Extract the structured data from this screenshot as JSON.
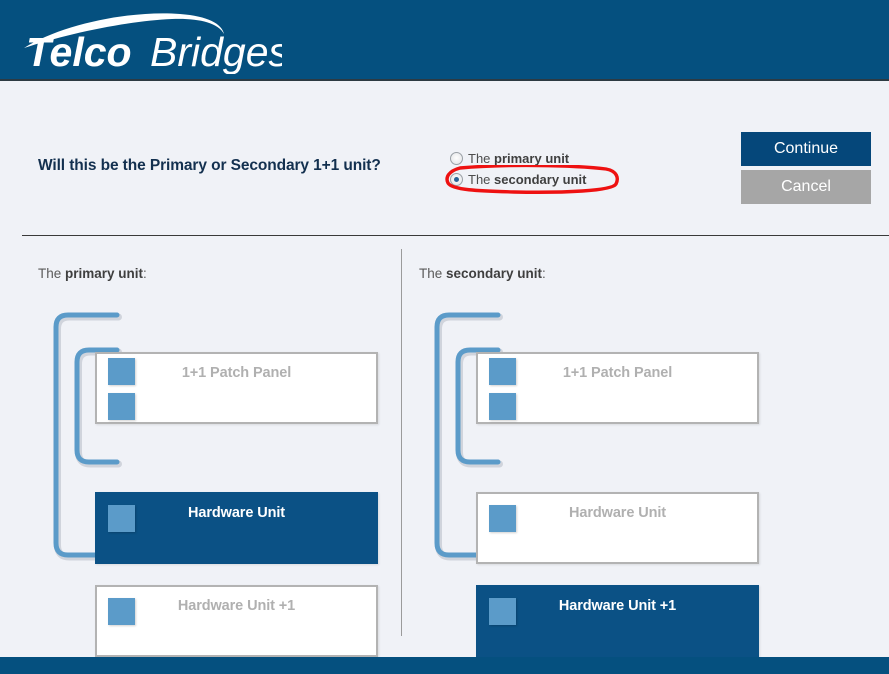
{
  "header": {
    "logo_text_1": "Telco",
    "logo_text_2": "Bridges",
    "brand_color": "#05507f"
  },
  "prompt": {
    "question": "Will this be the Primary or Secondary 1+1 unit?",
    "options": [
      {
        "prefix": "The ",
        "label": "primary unit",
        "selected": false
      },
      {
        "prefix": "The ",
        "label": "secondary unit",
        "selected": true
      }
    ],
    "annotation_color": "#ee1111"
  },
  "actions": {
    "continue_label": "Continue",
    "cancel_label": "Cancel",
    "continue_color": "#05477a",
    "cancel_color": "#a6a6a6"
  },
  "panels": [
    {
      "title_prefix": "The ",
      "title_label": "primary unit",
      "title_suffix": ":",
      "devices": [
        {
          "name": "1+1 Patch Panel",
          "active": false
        },
        {
          "name": "Hardware Unit",
          "active": true
        },
        {
          "name": "Hardware Unit +1",
          "active": false
        }
      ]
    },
    {
      "title_prefix": "The ",
      "title_label": "secondary unit",
      "title_suffix": ":",
      "devices": [
        {
          "name": "1+1 Patch Panel",
          "active": false
        },
        {
          "name": "Hardware Unit",
          "active": false
        },
        {
          "name": "Hardware Unit +1",
          "active": true
        }
      ]
    }
  ],
  "diagram_colors": {
    "box_border": "#b3b3b3",
    "box_active_fill": "#0b5185",
    "port_fill": "#5b9bc9",
    "cable": "#5b9bc9",
    "inactive_text": "#b0b0b0"
  }
}
